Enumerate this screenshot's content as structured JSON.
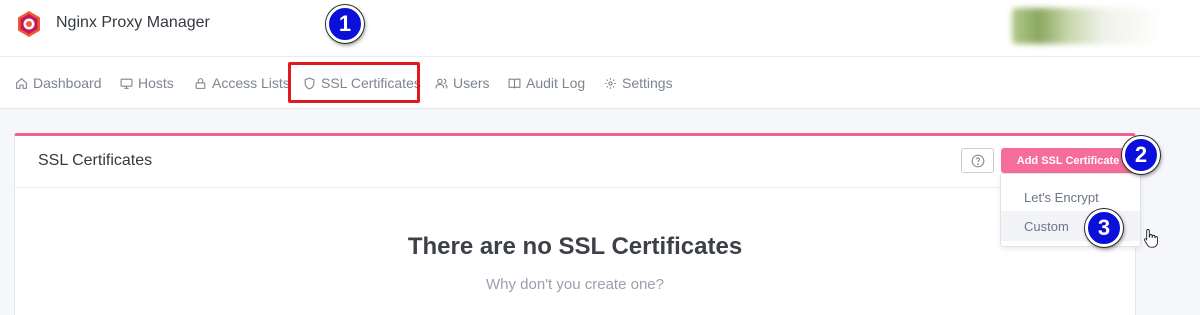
{
  "app": {
    "title": "Nginx Proxy Manager"
  },
  "nav": {
    "items": [
      {
        "label": "Dashboard",
        "icon": "home-icon"
      },
      {
        "label": "Hosts",
        "icon": "monitor-icon"
      },
      {
        "label": "Access Lists",
        "icon": "lock-icon"
      },
      {
        "label": "SSL Certificates",
        "icon": "shield-icon"
      },
      {
        "label": "Users",
        "icon": "users-icon"
      },
      {
        "label": "Audit Log",
        "icon": "book-icon"
      },
      {
        "label": "Settings",
        "icon": "gear-icon"
      }
    ]
  },
  "card": {
    "title": "SSL Certificates",
    "add_button": "Add SSL Certificate",
    "empty_title": "There are no SSL Certificates",
    "empty_subtitle": "Why don't you create one?"
  },
  "dropdown": {
    "items": [
      {
        "label": "Let's Encrypt"
      },
      {
        "label": "Custom"
      }
    ]
  },
  "steps": [
    "1",
    "2",
    "3"
  ],
  "colors": {
    "accent": "#f66d9b",
    "highlight": "#e0191f",
    "step_badge": "#0a10d8"
  }
}
